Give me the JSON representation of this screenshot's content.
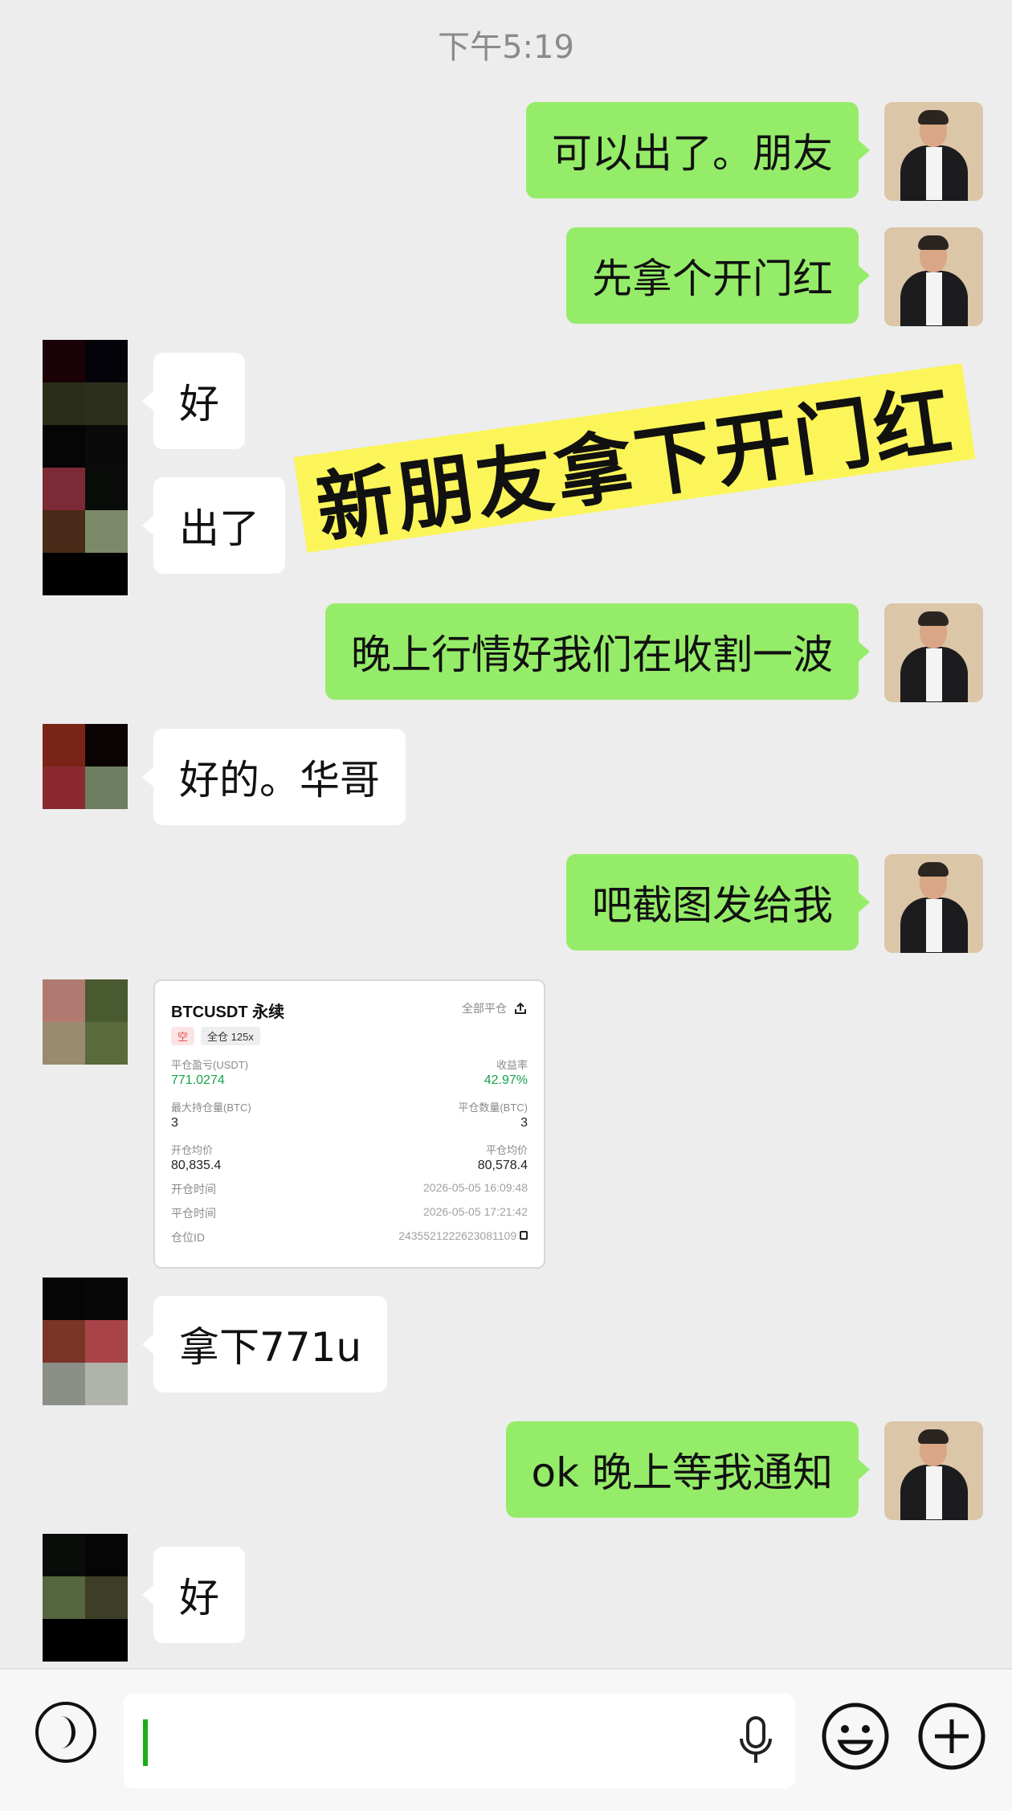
{
  "header": {
    "timestamp": "下午5:19"
  },
  "messages": [
    {
      "from": "me",
      "text": "可以出了。朋友"
    },
    {
      "from": "me",
      "text": "先拿个开门红"
    },
    {
      "from": "other",
      "text": "好"
    },
    {
      "from": "other",
      "text": "出了"
    },
    {
      "from": "me",
      "text": "晚上行情好我们在收割一波"
    },
    {
      "from": "other",
      "text": "好的。华哥"
    },
    {
      "from": "me",
      "text": "吧截图发给我"
    },
    {
      "from": "other",
      "text": "拿下771u"
    },
    {
      "from": "me",
      "text": "ok 晚上等我通知"
    },
    {
      "from": "other",
      "text": "好"
    }
  ],
  "banner": {
    "text": "新朋友拿下开门红"
  },
  "trade_card": {
    "symbol": "BTCUSDT 永续",
    "side_tag": "空",
    "margin_tag": "全仓 125x",
    "close_all_label": "全部平仓",
    "pnl_label": "平仓盈亏(USDT)",
    "pnl_value": "771.0274",
    "roi_label": "收益率",
    "roi_value": "42.97%",
    "max_pos_label": "最大持仓量(BTC)",
    "max_pos_value": "3",
    "close_qty_label": "平仓数量(BTC)",
    "close_qty_value": "3",
    "open_avg_label": "开仓均价",
    "open_avg_value": "80,835.4",
    "close_avg_label": "平仓均价",
    "close_avg_value": "80,578.4",
    "open_time_label": "开仓时间",
    "open_time_value": "2026-05-05 16:09:48",
    "close_time_label": "平仓时间",
    "close_time_value": "2026-05-05 17:21:42",
    "position_id_label": "仓位ID",
    "position_id_value": "2435521222623081109"
  },
  "colors": {
    "my_bubble": "#95ec69",
    "their_bubble": "#ffffff",
    "background": "#ededed",
    "banner": "#fbf55a",
    "profit_green": "#16a34a"
  },
  "input_bar": {
    "voice_icon": "voice-icon",
    "mic_icon": "microphone-icon",
    "emoji_icon": "emoji-icon",
    "plus_icon": "plus-icon"
  }
}
